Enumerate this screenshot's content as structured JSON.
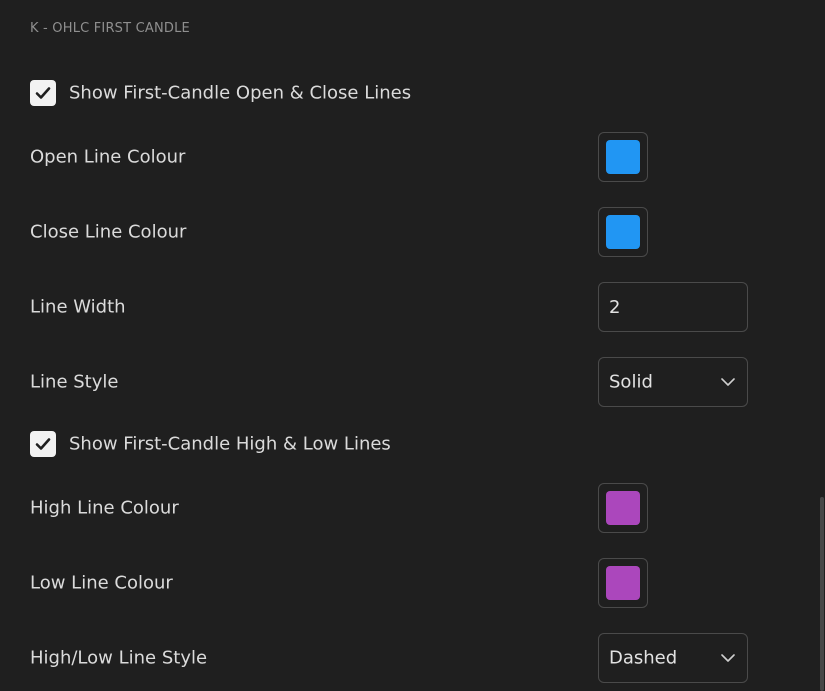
{
  "section": {
    "title": "K - OHLC FIRST CANDLE"
  },
  "open_close": {
    "toggle_label": "Show First-Candle Open & Close Lines",
    "toggle_checked": true,
    "open_color_label": "Open Line Colour",
    "open_color": "#2196f3",
    "close_color_label": "Close Line Colour",
    "close_color": "#2196f3",
    "line_width_label": "Line Width",
    "line_width_value": "2",
    "line_style_label": "Line Style",
    "line_style_value": "Solid"
  },
  "high_low": {
    "toggle_label": "Show First-Candle High & Low Lines",
    "toggle_checked": true,
    "high_color_label": "High Line Colour",
    "high_color": "#ab47bc",
    "low_color_label": "Low Line Colour",
    "low_color": "#ab47bc",
    "line_style_label": "High/Low Line Style",
    "line_style_value": "Dashed"
  },
  "icons": {
    "checkmark": "check-icon",
    "dropdown": "chevron-down-icon"
  }
}
